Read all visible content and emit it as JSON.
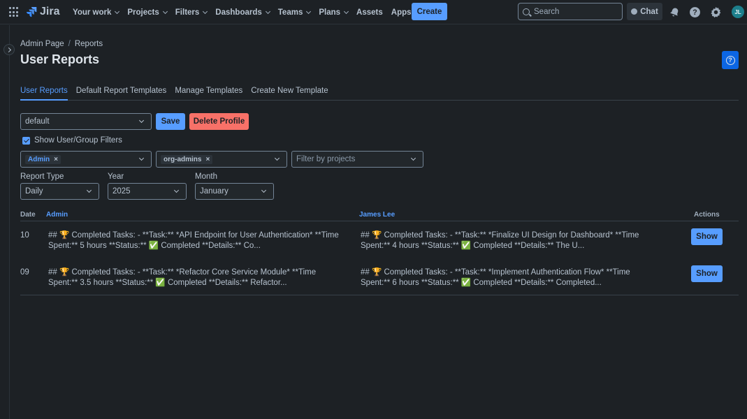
{
  "topnav": {
    "logo_text": "Jira",
    "items": [
      {
        "label": "Your work",
        "has_menu": true
      },
      {
        "label": "Projects",
        "has_menu": true
      },
      {
        "label": "Filters",
        "has_menu": true
      },
      {
        "label": "Dashboards",
        "has_menu": true
      },
      {
        "label": "Teams",
        "has_menu": true
      },
      {
        "label": "Plans",
        "has_menu": true
      },
      {
        "label": "Assets",
        "has_menu": false
      },
      {
        "label": "Apps",
        "has_menu": true
      }
    ],
    "create_label": "Create",
    "search_placeholder": "Search",
    "chat_label": "Chat",
    "avatar_initials": "JL",
    "icons": [
      "app-switcher-icon",
      "jira-logo",
      "notifications-icon",
      "help-icon",
      "settings-icon"
    ]
  },
  "breadcrumb": [
    "Admin Page",
    "Reports"
  ],
  "page": {
    "title": "User Reports",
    "help_icon": "?"
  },
  "tabs": [
    "User Reports",
    "Default Report Templates",
    "Manage Templates",
    "Create New Template"
  ],
  "profile": {
    "selected": "default",
    "save_label": "Save",
    "delete_label": "Delete Profile"
  },
  "filters": {
    "show_filters_label": "Show User/Group Filters",
    "show_filters_checked": true,
    "user_tag": "Admin",
    "group_tag": "org-admins",
    "projects_placeholder": "Filter by projects"
  },
  "report": {
    "type_label": "Report Type",
    "type_value": "Daily",
    "year_label": "Year",
    "year_value": "2025",
    "month_label": "Month",
    "month_value": "January"
  },
  "table": {
    "headers": {
      "date": "Date",
      "user1": "Admin",
      "user2": "James Lee",
      "actions": "Actions"
    },
    "rows": [
      {
        "date": "10",
        "user1": "## 🏆 Completed Tasks: - **Task:** *API Endpoint for User Authentication* **Time Spent:** 5 hours **Status:** ✅ Completed **Details:** Co...",
        "user2": "## 🏆 Completed Tasks: - **Task:** *Finalize UI Design for Dashboard* **Time Spent:** 4 hours **Status:** ✅ Completed **Details:** The U...",
        "action": "Show"
      },
      {
        "date": "09",
        "user1": "## 🏆 Completed Tasks: - **Task:** *Refactor Core Service Module* **Time Spent:** 3.5 hours **Status:** ✅ Completed **Details:** Refactor...",
        "user2": "## 🏆 Completed Tasks: - **Task:** *Implement Authentication Flow* **Time Spent:** 6 hours **Status:** ✅ Completed **Details:** Completed...",
        "action": "Show"
      }
    ]
  },
  "colors": {
    "background": "#1d2125",
    "accent": "#579dff",
    "danger": "#f87168",
    "text": "#b6c2cf"
  }
}
